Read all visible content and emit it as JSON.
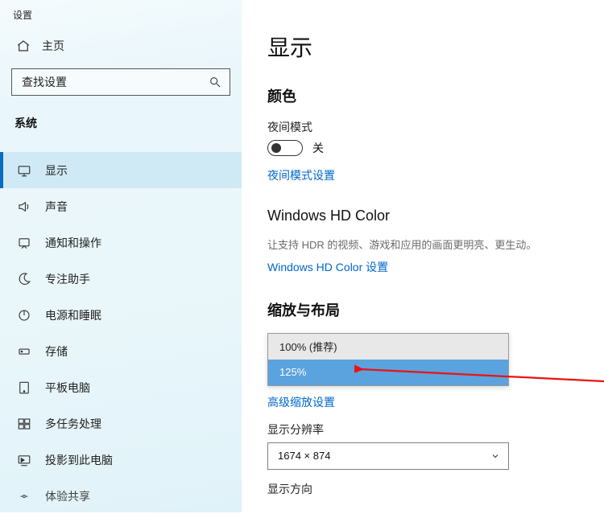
{
  "window": {
    "title": "设置"
  },
  "sidebar": {
    "home": "主页",
    "search_placeholder": "查找设置",
    "section": "系统",
    "items": [
      {
        "label": "显示"
      },
      {
        "label": "声音"
      },
      {
        "label": "通知和操作"
      },
      {
        "label": "专注助手"
      },
      {
        "label": "电源和睡眠"
      },
      {
        "label": "存储"
      },
      {
        "label": "平板电脑"
      },
      {
        "label": "多任务处理"
      },
      {
        "label": "投影到此电脑"
      },
      {
        "label": "体验共享"
      }
    ]
  },
  "main": {
    "title": "显示",
    "color": {
      "heading": "颜色",
      "night_label": "夜间模式",
      "toggle_state": "关",
      "night_link": "夜间模式设置"
    },
    "hdr": {
      "heading": "Windows HD Color",
      "desc": "让支持 HDR 的视频、游戏和应用的画面更明亮、更生动。",
      "link": "Windows HD Color 设置"
    },
    "scale": {
      "heading": "缩放与布局",
      "options": [
        {
          "label": "100% (推荐)"
        },
        {
          "label": "125%"
        }
      ],
      "adv_link": "高级缩放设置",
      "res_label": "显示分辨率",
      "res_value": "1674 × 874",
      "orient_label": "显示方向"
    }
  }
}
